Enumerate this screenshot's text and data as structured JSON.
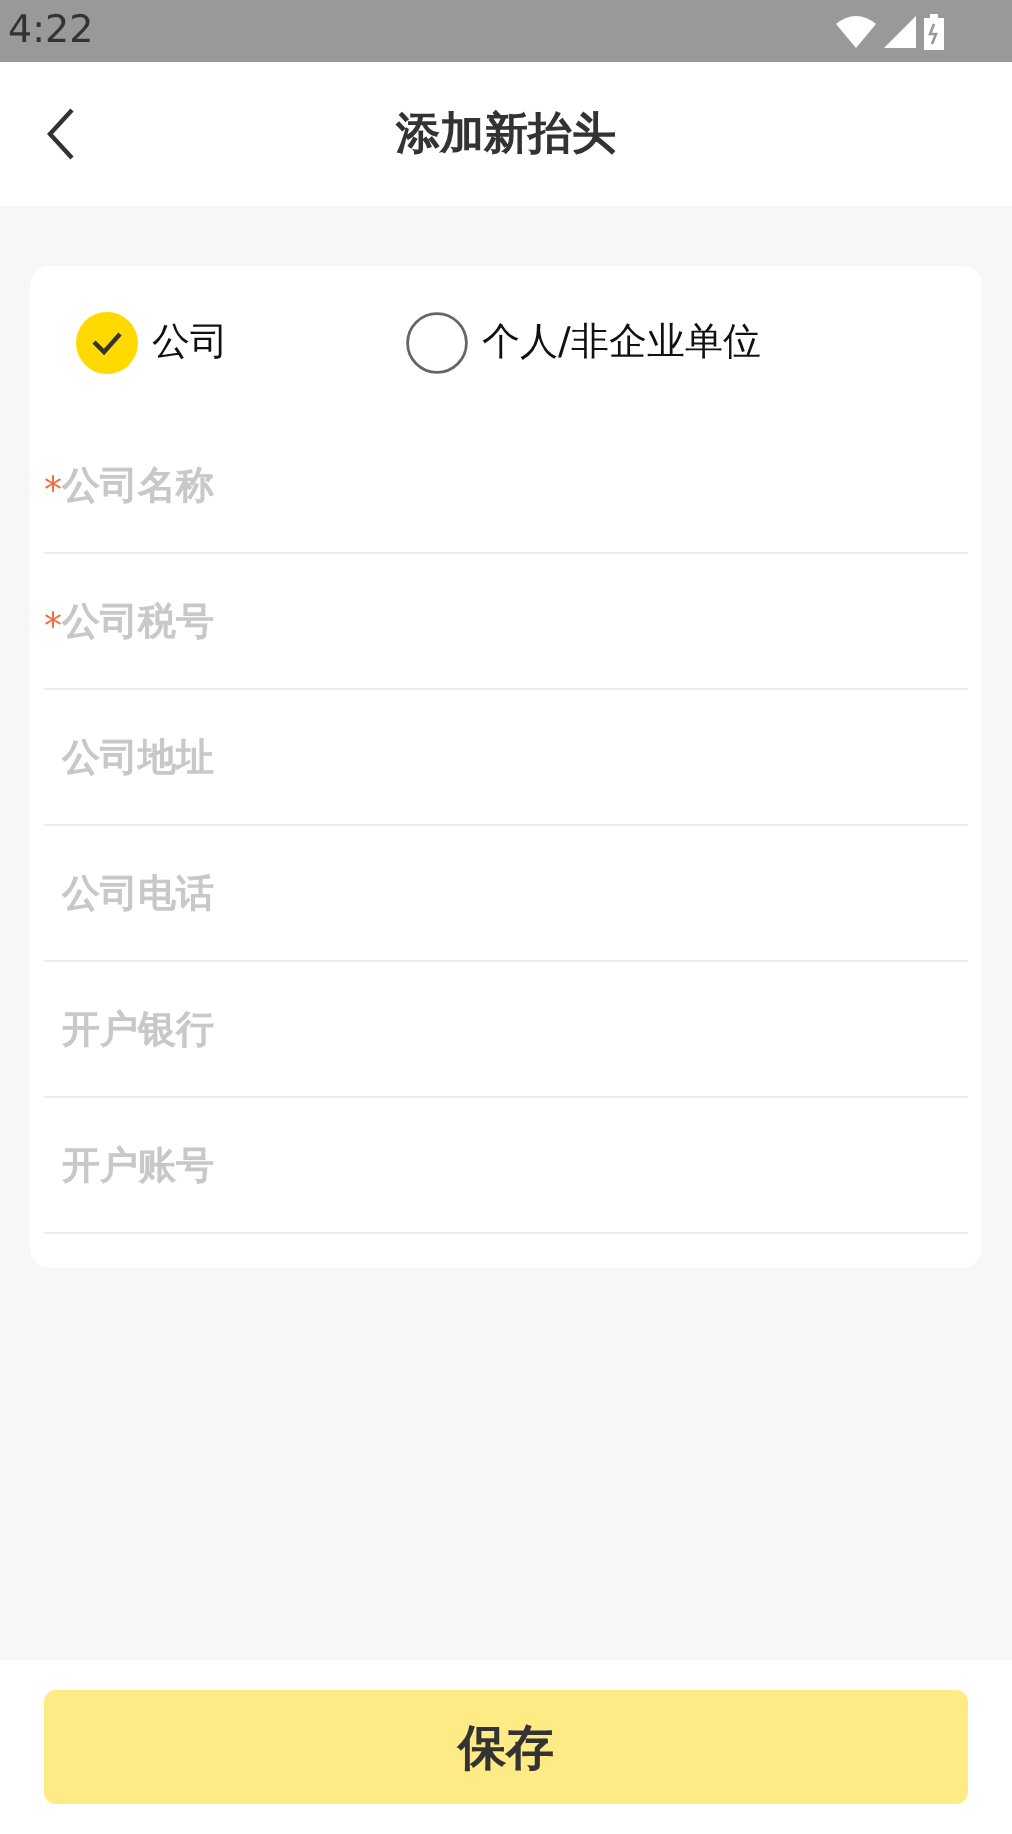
{
  "status_bar": {
    "time": "4:22"
  },
  "header": {
    "title": "添加新抬头"
  },
  "invoice_types": [
    {
      "label": "公司",
      "selected": true
    },
    {
      "label": "个人/非企业单位",
      "selected": false
    }
  ],
  "fields": [
    {
      "required_mark": "*",
      "placeholder": "公司名称"
    },
    {
      "required_mark": "*",
      "placeholder": "公司税号"
    },
    {
      "placeholder": "公司地址"
    },
    {
      "placeholder": "公司电话"
    },
    {
      "placeholder": "开户银行"
    },
    {
      "placeholder": "开户账号"
    }
  ],
  "save_button": {
    "label": "保存"
  }
}
